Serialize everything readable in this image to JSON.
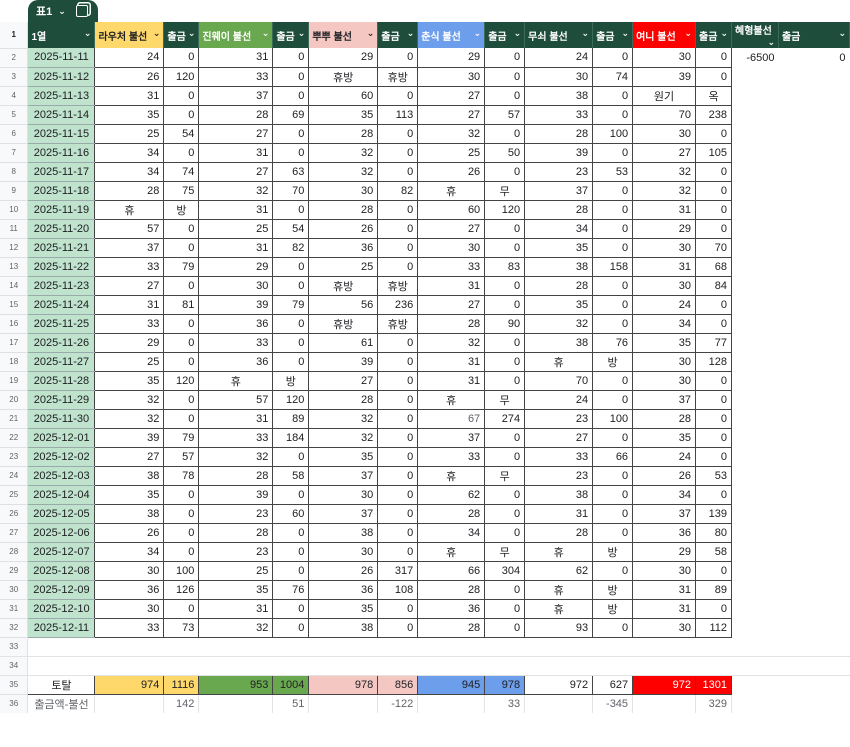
{
  "table_tab": {
    "name": "표1"
  },
  "header_row_number": "1",
  "headers": [
    {
      "label": "1열",
      "color": "dark"
    },
    {
      "label": "라우처 불선",
      "color": "yellow"
    },
    {
      "label": "출금",
      "color": "dark"
    },
    {
      "label": "진웨이 불선",
      "color": "green"
    },
    {
      "label": "출금",
      "color": "dark"
    },
    {
      "label": "뿌뿌 불선",
      "color": "pink"
    },
    {
      "label": "출금",
      "color": "dark"
    },
    {
      "label": "춘식 불선",
      "color": "blue"
    },
    {
      "label": "출금",
      "color": "dark"
    },
    {
      "label": "무쇠 불선",
      "color": "dark"
    },
    {
      "label": "출금",
      "color": "dark"
    },
    {
      "label": "여니 불선",
      "color": "red"
    },
    {
      "label": "출금",
      "color": "dark"
    },
    {
      "label": "혜형불선",
      "color": "dark"
    },
    {
      "label": "출금",
      "color": "dark"
    }
  ],
  "extra_row2": [
    "-6500",
    "0"
  ],
  "rows": [
    {
      "n": "2",
      "date": "2025-11-11",
      "v": [
        "24",
        "0",
        "31",
        "0",
        "29",
        "0",
        "29",
        "0",
        "24",
        "0",
        "30",
        "0"
      ]
    },
    {
      "n": "3",
      "date": "2025-11-12",
      "v": [
        "26",
        "120",
        "33",
        "0",
        "휴방",
        "휴방",
        "30",
        "0",
        "30",
        "74",
        "39",
        "0"
      ]
    },
    {
      "n": "4",
      "date": "2025-11-13",
      "v": [
        "31",
        "0",
        "37",
        "0",
        "60",
        "0",
        "27",
        "0",
        "38",
        "0",
        "원기",
        "옥"
      ]
    },
    {
      "n": "5",
      "date": "2025-11-14",
      "v": [
        "35",
        "0",
        "28",
        "69",
        "35",
        "113",
        "27",
        "57",
        "33",
        "0",
        "70",
        "238"
      ]
    },
    {
      "n": "6",
      "date": "2025-11-15",
      "v": [
        "25",
        "54",
        "27",
        "0",
        "28",
        "0",
        "32",
        "0",
        "28",
        "100",
        "30",
        "0"
      ]
    },
    {
      "n": "7",
      "date": "2025-11-16",
      "v": [
        "34",
        "0",
        "31",
        "0",
        "32",
        "0",
        "25",
        "50",
        "39",
        "0",
        "27",
        "105"
      ]
    },
    {
      "n": "8",
      "date": "2025-11-17",
      "v": [
        "34",
        "74",
        "27",
        "63",
        "32",
        "0",
        "26",
        "0",
        "23",
        "53",
        "32",
        "0"
      ]
    },
    {
      "n": "9",
      "date": "2025-11-18",
      "v": [
        "28",
        "75",
        "32",
        "70",
        "30",
        "82",
        "휴",
        "무",
        "37",
        "0",
        "32",
        "0"
      ]
    },
    {
      "n": "10",
      "date": "2025-11-19",
      "v": [
        "휴",
        "방",
        "31",
        "0",
        "28",
        "0",
        "60",
        "120",
        "28",
        "0",
        "31",
        "0"
      ]
    },
    {
      "n": "11",
      "date": "2025-11-20",
      "v": [
        "57",
        "0",
        "25",
        "54",
        "26",
        "0",
        "27",
        "0",
        "34",
        "0",
        "29",
        "0"
      ]
    },
    {
      "n": "12",
      "date": "2025-11-21",
      "v": [
        "37",
        "0",
        "31",
        "82",
        "36",
        "0",
        "30",
        "0",
        "35",
        "0",
        "30",
        "70"
      ]
    },
    {
      "n": "13",
      "date": "2025-11-22",
      "v": [
        "33",
        "79",
        "29",
        "0",
        "25",
        "0",
        "33",
        "83",
        "38",
        "158",
        "31",
        "68"
      ]
    },
    {
      "n": "14",
      "date": "2025-11-23",
      "v": [
        "27",
        "0",
        "30",
        "0",
        "휴방",
        "휴방",
        "31",
        "0",
        "28",
        "0",
        "30",
        "84"
      ]
    },
    {
      "n": "15",
      "date": "2025-11-24",
      "v": [
        "31",
        "81",
        "39",
        "79",
        "56",
        "236",
        "27",
        "0",
        "35",
        "0",
        "24",
        "0"
      ]
    },
    {
      "n": "16",
      "date": "2025-11-25",
      "v": [
        "33",
        "0",
        "36",
        "0",
        "휴방",
        "휴방",
        "28",
        "90",
        "32",
        "0",
        "34",
        "0"
      ]
    },
    {
      "n": "17",
      "date": "2025-11-26",
      "v": [
        "29",
        "0",
        "33",
        "0",
        "61",
        "0",
        "32",
        "0",
        "38",
        "76",
        "35",
        "77"
      ]
    },
    {
      "n": "18",
      "date": "2025-11-27",
      "v": [
        "25",
        "0",
        "36",
        "0",
        "39",
        "0",
        "31",
        "0",
        "휴",
        "방",
        "30",
        "128"
      ]
    },
    {
      "n": "19",
      "date": "2025-11-28",
      "v": [
        "35",
        "120",
        "휴",
        "방",
        "27",
        "0",
        "31",
        "0",
        "70",
        "0",
        "30",
        "0"
      ]
    },
    {
      "n": "20",
      "date": "2025-11-29",
      "v": [
        "32",
        "0",
        "57",
        "120",
        "28",
        "0",
        "휴",
        "무",
        "24",
        "0",
        "37",
        "0"
      ]
    },
    {
      "n": "21",
      "date": "2025-11-30",
      "v": [
        "32",
        "0",
        "31",
        "89",
        "32",
        "0",
        "67",
        "274",
        "23",
        "100",
        "28",
        "0"
      ]
    },
    {
      "n": "22",
      "date": "2025-12-01",
      "v": [
        "39",
        "79",
        "33",
        "184",
        "32",
        "0",
        "37",
        "0",
        "27",
        "0",
        "35",
        "0"
      ]
    },
    {
      "n": "23",
      "date": "2025-12-02",
      "v": [
        "27",
        "57",
        "32",
        "0",
        "35",
        "0",
        "33",
        "0",
        "33",
        "66",
        "24",
        "0"
      ]
    },
    {
      "n": "24",
      "date": "2025-12-03",
      "v": [
        "38",
        "78",
        "28",
        "58",
        "37",
        "0",
        "휴",
        "무",
        "23",
        "0",
        "26",
        "53"
      ]
    },
    {
      "n": "25",
      "date": "2025-12-04",
      "v": [
        "35",
        "0",
        "39",
        "0",
        "30",
        "0",
        "62",
        "0",
        "38",
        "0",
        "34",
        "0"
      ]
    },
    {
      "n": "26",
      "date": "2025-12-05",
      "v": [
        "38",
        "0",
        "23",
        "60",
        "37",
        "0",
        "28",
        "0",
        "31",
        "0",
        "37",
        "139"
      ]
    },
    {
      "n": "27",
      "date": "2025-12-06",
      "v": [
        "26",
        "0",
        "28",
        "0",
        "38",
        "0",
        "34",
        "0",
        "28",
        "0",
        "36",
        "80"
      ]
    },
    {
      "n": "28",
      "date": "2025-12-07",
      "v": [
        "34",
        "0",
        "23",
        "0",
        "30",
        "0",
        "휴",
        "무",
        "휴",
        "방",
        "29",
        "58"
      ]
    },
    {
      "n": "29",
      "date": "2025-12-08",
      "v": [
        "30",
        "100",
        "25",
        "0",
        "26",
        "317",
        "66",
        "304",
        "62",
        "0",
        "30",
        "0"
      ]
    },
    {
      "n": "30",
      "date": "2025-12-09",
      "v": [
        "36",
        "126",
        "35",
        "76",
        "36",
        "108",
        "28",
        "0",
        "휴",
        "방",
        "31",
        "89"
      ]
    },
    {
      "n": "31",
      "date": "2025-12-10",
      "v": [
        "30",
        "0",
        "31",
        "0",
        "35",
        "0",
        "36",
        "0",
        "휴",
        "방",
        "31",
        "0"
      ]
    },
    {
      "n": "32",
      "date": "2025-12-11",
      "v": [
        "33",
        "73",
        "32",
        "0",
        "38",
        "0",
        "28",
        "0",
        "93",
        "0",
        "30",
        "112"
      ]
    }
  ],
  "blank_rows": [
    "33",
    "34"
  ],
  "total_row": {
    "n": "35",
    "label": "토탈",
    "v": [
      "974",
      "1116",
      "953",
      "1004",
      "978",
      "856",
      "945",
      "978",
      "972",
      "627",
      "972",
      "1301"
    ]
  },
  "diff_row": {
    "n": "36",
    "label": "출금액-불선",
    "v": [
      "",
      "142",
      "",
      "51",
      "",
      "-122",
      "",
      "33",
      "",
      "-345",
      "",
      "329"
    ]
  }
}
